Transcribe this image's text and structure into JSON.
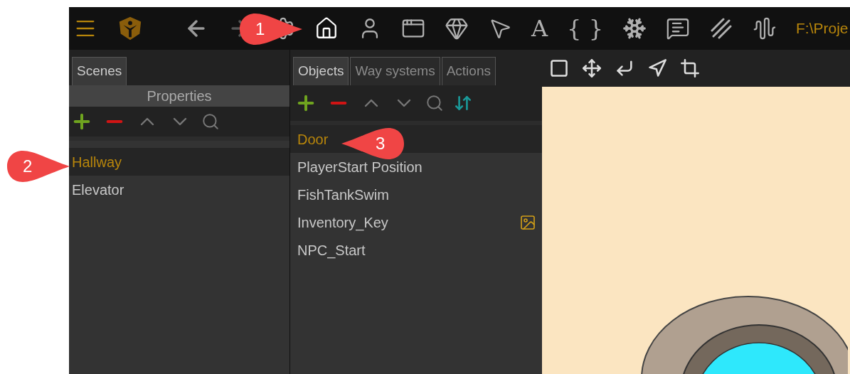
{
  "toolbar": {
    "items": [
      {
        "kind": "menu"
      },
      {
        "kind": "logo"
      },
      {
        "kind": "back"
      },
      {
        "kind": "forward"
      },
      {
        "kind": "gear"
      },
      {
        "kind": "home",
        "selected": true
      },
      {
        "kind": "person"
      },
      {
        "kind": "dialog"
      },
      {
        "kind": "diamond"
      },
      {
        "kind": "cursor"
      },
      {
        "kind": "glyph",
        "text": "A"
      },
      {
        "kind": "glyph",
        "text": "{ }"
      },
      {
        "kind": "snowflake"
      },
      {
        "kind": "comment"
      },
      {
        "kind": "stripes"
      },
      {
        "kind": "waveform"
      }
    ],
    "path": "F:\\Proje"
  },
  "scenes_panel": {
    "tabs": [
      {
        "label": "Scenes",
        "selected": true
      }
    ],
    "header": "Properties",
    "tools": [
      {
        "kind": "add"
      },
      {
        "kind": "remove"
      },
      {
        "kind": "up"
      },
      {
        "kind": "down"
      },
      {
        "kind": "search"
      }
    ],
    "items": [
      {
        "label": "Hallway",
        "selected": true
      },
      {
        "label": "Elevator",
        "selected": false
      }
    ]
  },
  "objects_panel": {
    "tabs": [
      {
        "label": "Objects",
        "selected": true
      },
      {
        "label": "Way systems",
        "selected": false
      },
      {
        "label": "Actions",
        "selected": false
      }
    ],
    "tools": [
      {
        "kind": "add"
      },
      {
        "kind": "remove"
      },
      {
        "kind": "up"
      },
      {
        "kind": "down"
      },
      {
        "kind": "search"
      },
      {
        "kind": "sort"
      }
    ],
    "items": [
      {
        "label": "Door",
        "selected": true,
        "has_image": false
      },
      {
        "label": "PlayerStart Position",
        "selected": false,
        "has_image": false
      },
      {
        "label": "FishTankSwim",
        "selected": false,
        "has_image": false
      },
      {
        "label": "Inventory_Key",
        "selected": false,
        "has_image": true
      },
      {
        "label": "NPC_Start",
        "selected": false,
        "has_image": false
      }
    ]
  },
  "canvas": {
    "tools": [
      {
        "kind": "select"
      },
      {
        "kind": "move"
      },
      {
        "kind": "enter"
      },
      {
        "kind": "navigate"
      },
      {
        "kind": "crop"
      }
    ]
  },
  "callouts": [
    {
      "label": "1",
      "kind": "right"
    },
    {
      "label": "2",
      "kind": "right"
    },
    {
      "label": "3",
      "kind": "left"
    }
  ]
}
